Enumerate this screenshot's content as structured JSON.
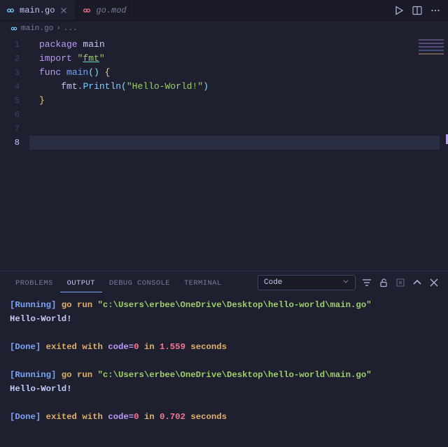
{
  "tabs": [
    {
      "label": "main.go",
      "active": true,
      "closable": true
    },
    {
      "label": "go.mod",
      "active": false,
      "closable": false
    }
  ],
  "breadcrumb": {
    "file": "main.go",
    "sep": "›",
    "trail": "..."
  },
  "editor": {
    "lines": [
      {
        "n": "1",
        "tokens": [
          [
            "kw",
            "package "
          ],
          [
            "pkg",
            "main"
          ]
        ]
      },
      {
        "n": "2",
        "tokens": []
      },
      {
        "n": "3",
        "tokens": [
          [
            "kw",
            "import "
          ],
          [
            "str",
            "\""
          ],
          [
            "str-u",
            "fmt"
          ],
          [
            "str",
            "\""
          ]
        ]
      },
      {
        "n": "4",
        "tokens": []
      },
      {
        "n": "5",
        "tokens": [
          [
            "kw",
            "func "
          ],
          [
            "func",
            "main"
          ],
          [
            "punc",
            "()"
          ],
          [
            "txt",
            " "
          ],
          [
            "brace",
            "{"
          ]
        ]
      },
      {
        "n": "6",
        "tokens": [
          [
            "txt",
            "    "
          ],
          [
            "obj",
            "fmt"
          ],
          [
            "txt",
            "."
          ],
          [
            "call",
            "Println"
          ],
          [
            "punc",
            "("
          ],
          [
            "str",
            "\"Hello-World!\""
          ],
          [
            "punc",
            ")"
          ]
        ]
      },
      {
        "n": "7",
        "tokens": [
          [
            "brace",
            "}"
          ]
        ]
      },
      {
        "n": "8",
        "tokens": []
      }
    ],
    "active_line": 8
  },
  "panel": {
    "tabs": [
      {
        "label": "PROBLEMS",
        "active": false
      },
      {
        "label": "OUTPUT",
        "active": true
      },
      {
        "label": "DEBUG CONSOLE",
        "active": false
      },
      {
        "label": "TERMINAL",
        "active": false
      }
    ],
    "filter": "Code",
    "output_runs": [
      {
        "running_label": "[Running]",
        "cmd": " go run ",
        "path": "\"c:\\Users\\erbee\\OneDrive\\Desktop\\hello-world\\main.go\"",
        "stdout": "Hello-World!",
        "done_label": "[Done]",
        "done_text": " exited with ",
        "code_key": "code=",
        "code_val": "0",
        "in_text": " in ",
        "seconds": "1.559",
        "seconds_suffix": " seconds"
      },
      {
        "running_label": "[Running]",
        "cmd": " go run ",
        "path": "\"c:\\Users\\erbee\\OneDrive\\Desktop\\hello-world\\main.go\"",
        "stdout": "Hello-World!",
        "done_label": "[Done]",
        "done_text": " exited with ",
        "code_key": "code=",
        "code_val": "0",
        "in_text": " in ",
        "seconds": "0.702",
        "seconds_suffix": " seconds"
      }
    ]
  }
}
